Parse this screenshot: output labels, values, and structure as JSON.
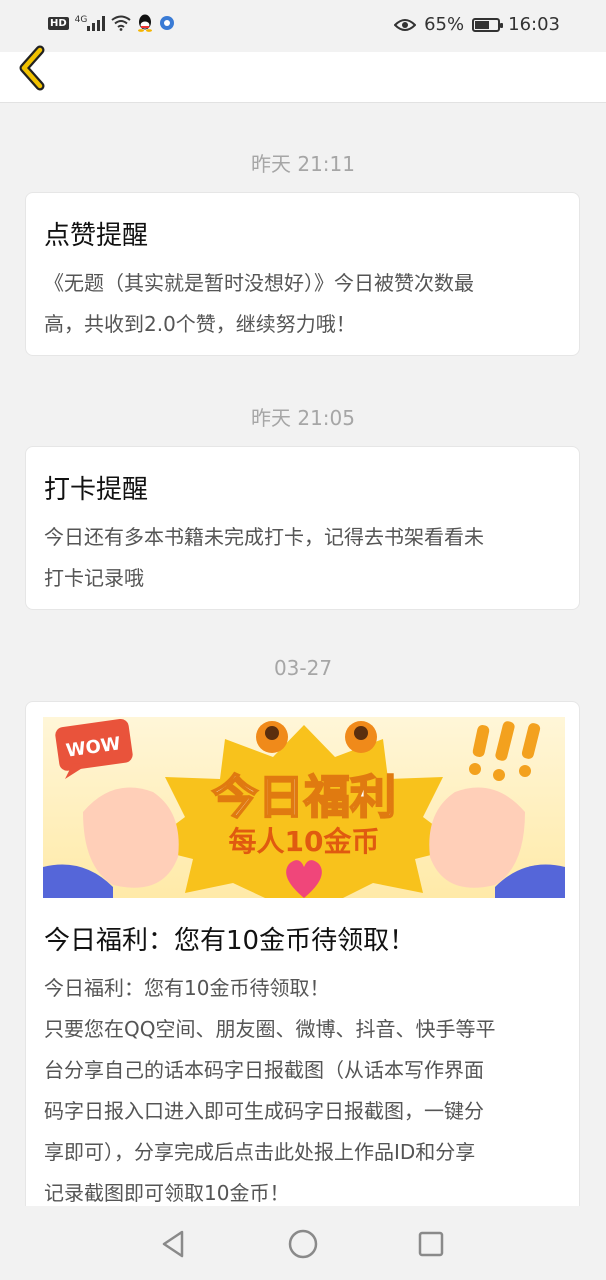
{
  "status_bar": {
    "network_badge": "HD",
    "signal_type": "4G",
    "battery_percent": "65%",
    "battery_level": 0.65,
    "time": "16:03",
    "icons": [
      "hd-icon",
      "signal-icon",
      "wifi-icon",
      "qq-icon",
      "browser-icon",
      "eye-icon",
      "battery-icon"
    ]
  },
  "header": {
    "back_icon": "chevron-left-icon",
    "accent": "#f2c200"
  },
  "messages": [
    {
      "time": "昨天 21:11",
      "title": "点赞提醒",
      "body_lines": [
        "《无题（其实就是暂时没想好）》今日被赞次数最",
        "高，共收到2.0个赞，继续努力哦！"
      ]
    },
    {
      "time": "昨天 21:05",
      "title": "打卡提醒",
      "body_lines": [
        "今日还有多本书籍未完成打卡，记得去书架看看未",
        "打卡记录哦"
      ]
    },
    {
      "time": "03-27",
      "banner": {
        "bubble": "WOW",
        "headline": "今日福利",
        "sub": "每人10金币"
      },
      "title": "今日福利：您有10金币待领取！",
      "body_lines": [
        "今日福利：您有10金币待领取！",
        "只要您在QQ空间、朋友圈、微博、抖音、快手等平",
        "台分享自己的话本码字日报截图（从话本写作界面",
        "码字日报入口进入即可生成码字日报截图，一键分",
        "享即可），分享完成后点击此处报上作品ID和分享",
        "记录截图即可领取10金币！"
      ]
    }
  ],
  "nav_bar": {
    "icons": [
      "back-triangle-icon",
      "home-circle-icon",
      "recents-square-icon"
    ]
  }
}
